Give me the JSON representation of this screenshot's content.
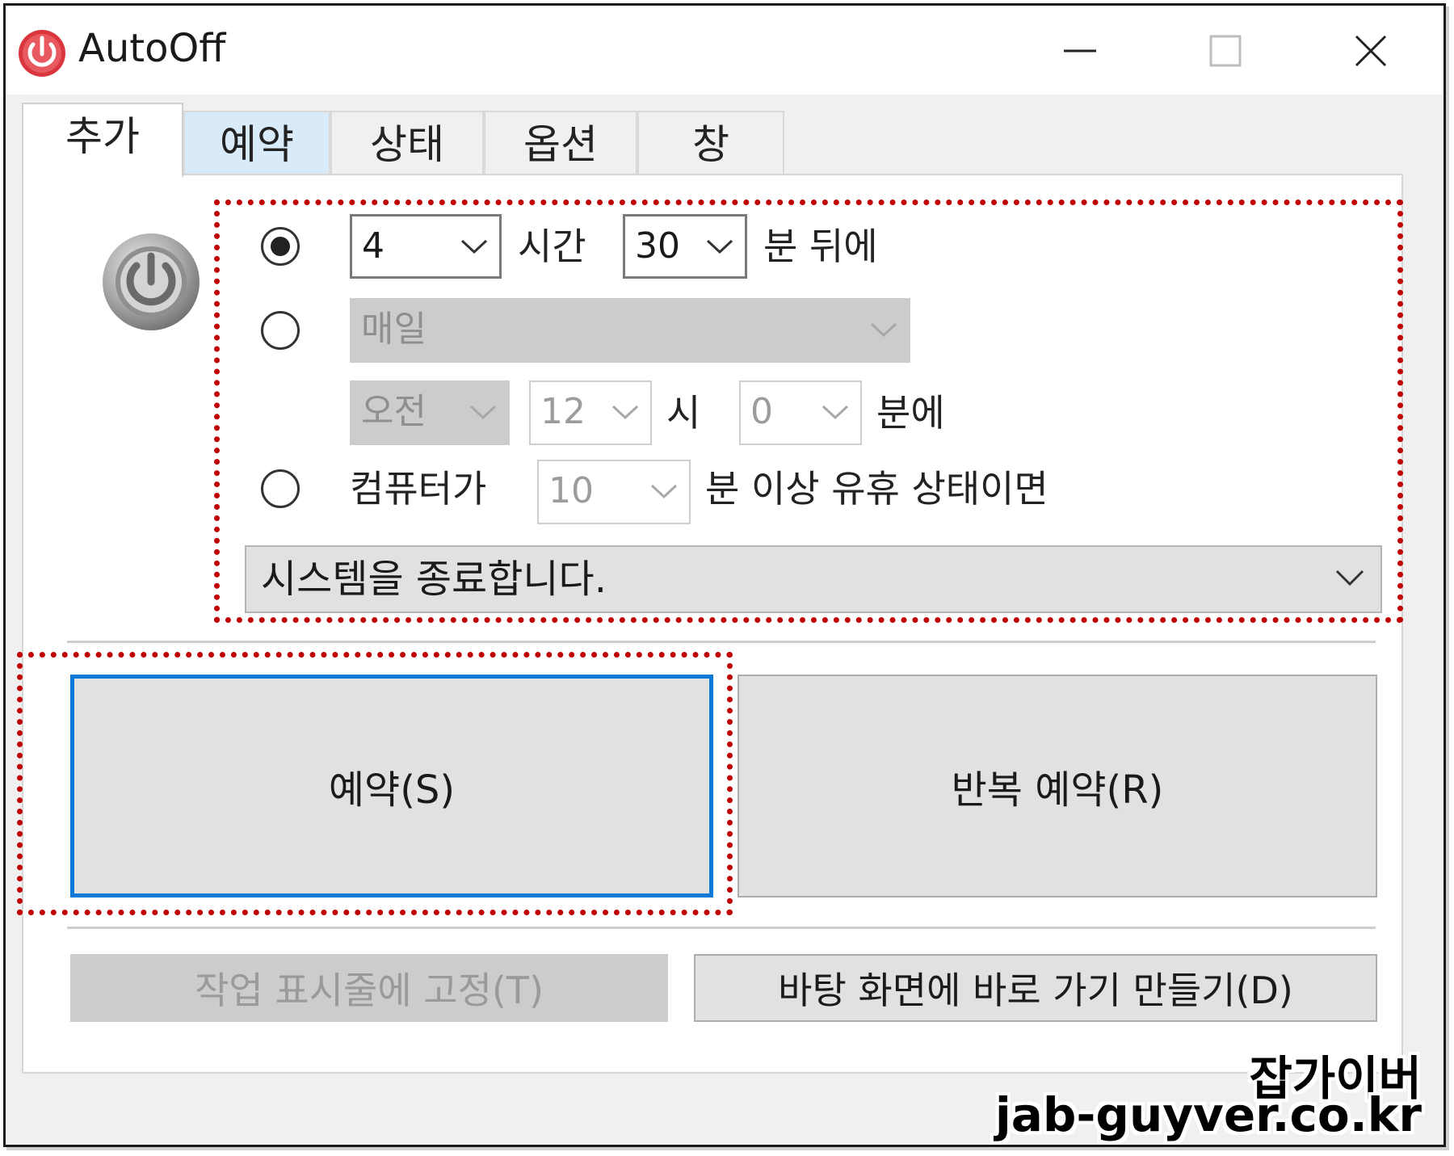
{
  "window": {
    "title": "AutoOff",
    "accent_color": "#d9363e",
    "focus_color": "#0a78d7",
    "highlight_color": "#c00000"
  },
  "tabs": [
    {
      "label": "추가",
      "state": "active"
    },
    {
      "label": "예약",
      "state": "hover"
    },
    {
      "label": "상태",
      "state": "normal"
    },
    {
      "label": "옵션",
      "state": "normal"
    },
    {
      "label": "창",
      "state": "normal"
    }
  ],
  "schedule": {
    "option1": {
      "selected": true,
      "hours_value": "4",
      "hours_label": "시간",
      "minutes_value": "30",
      "minutes_label": "분 뒤에"
    },
    "option2": {
      "selected": false,
      "repeat_value": "매일",
      "ampm_value": "오전",
      "hour_value": "12",
      "hour_label": "시",
      "minute_value": "0",
      "minute_label": "분에"
    },
    "option3": {
      "selected": false,
      "prefix_label": "컴퓨터가",
      "idle_value": "10",
      "suffix_label": "분 이상 유휴 상태이면"
    },
    "action_value": "시스템을 종료합니다."
  },
  "buttons": {
    "schedule": "예약(S)",
    "repeat_schedule": "반복 예약(R)",
    "pin_taskbar": "작업 표시줄에 고정(T)",
    "desktop_shortcut": "바탕 화면에 바로 가기 만들기(D)"
  },
  "watermark": {
    "line1": "잡가이버",
    "line2": "jab-guyver.co.kr"
  }
}
